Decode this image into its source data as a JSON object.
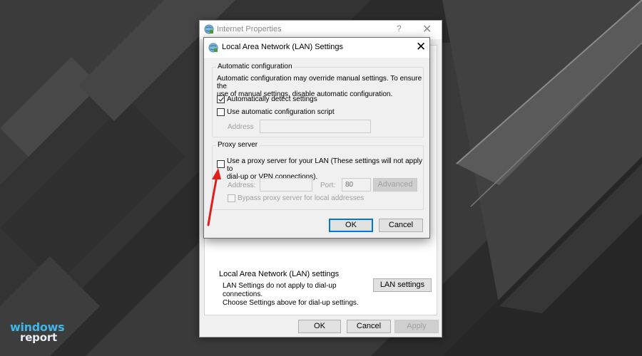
{
  "parent_window": {
    "title": "Internet Properties",
    "help_glyph": "?",
    "close_glyph": "✕",
    "lan_settings_group": {
      "legend": "Local Area Network (LAN) settings",
      "description_line1": "LAN Settings do not apply to dial-up connections.",
      "description_line2": "Choose Settings above for dial-up settings.",
      "button_label": "LAN settings"
    },
    "footer": {
      "ok_label": "OK",
      "cancel_label": "Cancel",
      "apply_label": "Apply"
    }
  },
  "dialog": {
    "title": "Local Area Network (LAN) Settings",
    "close_glyph": "✕",
    "automatic_configuration": {
      "legend": "Automatic configuration",
      "description_line1": "Automatic configuration may override manual settings.  To ensure the",
      "description_line2": "use of manual settings, disable automatic configuration.",
      "auto_detect_label": "Automatically detect settings",
      "auto_detect_checked": true,
      "use_script_label": "Use automatic configuration script",
      "use_script_checked": false,
      "address_label": "Address",
      "address_value": ""
    },
    "proxy_server": {
      "legend": "Proxy server",
      "use_proxy_label_line1": "Use a proxy server for your LAN (These settings will not apply to",
      "use_proxy_label_line2": "dial-up or VPN connections).",
      "use_proxy_checked": false,
      "address_label": "Address:",
      "address_value": "",
      "port_label": "Port:",
      "port_value": "80",
      "advanced_label": "Advanced",
      "bypass_label": "Bypass proxy server for local addresses",
      "bypass_checked": false
    },
    "ok_label": "OK",
    "cancel_label": "Cancel"
  },
  "logo": {
    "line1": "windows",
    "line2": "report"
  },
  "colors": {
    "annotation_arrow": "#e0201c",
    "focus_blue": "#0078d7",
    "logo_blue": "#3fb6e6"
  },
  "icons": {
    "window_icon": "internet-options-icon",
    "annotation": "red-arrow-icon"
  }
}
